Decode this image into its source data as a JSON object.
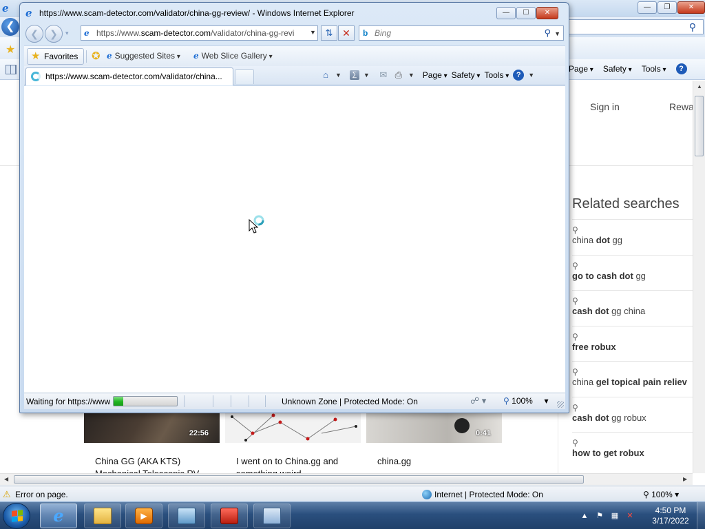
{
  "bg_window": {
    "cmd_menu": [
      "Page",
      "Safety",
      "Tools"
    ],
    "help": "?",
    "page": {
      "sign_in": "Sign in",
      "rewards": "Rewa",
      "related": {
        "title": "Related searches",
        "items": [
          {
            "pre": "china ",
            "bold": "dot",
            "post": " gg"
          },
          {
            "pre": "",
            "bold": "go to cash dot",
            "post": " gg"
          },
          {
            "pre": "",
            "bold": "cash dot",
            "post": " gg china"
          },
          {
            "pre": "",
            "bold": "free robux",
            "post": ""
          },
          {
            "pre": "china ",
            "bold": "gel topical pain reliev",
            "post": ""
          },
          {
            "pre": "",
            "bold": "cash dot",
            "post": " gg robux"
          },
          {
            "pre": "",
            "bold": "how to get robux",
            "post": ""
          }
        ]
      },
      "videos": [
        {
          "duration": "22:56",
          "title": "China GG (AKA KTS) Mechanical Telescopic RV"
        },
        {
          "duration": "",
          "title": "I went on to China.gg and something weird"
        },
        {
          "duration": "0:41",
          "title": "china.gg"
        }
      ]
    },
    "status": {
      "text": "Error on page.",
      "zone": "Internet | Protected Mode: On",
      "zoom": "100%"
    }
  },
  "fg_window": {
    "title": "https://www.scam-detector.com/validator/china-gg-review/ - Windows Internet Explorer",
    "address_prefix": "https://www.",
    "address_host": "scam-detector.com",
    "address_path": "/validator/china-gg-revi",
    "search_placeholder": "Bing",
    "favorites_label": "Favorites",
    "suggested_sites": "Suggested Sites",
    "web_slice_gallery": "Web Slice Gallery",
    "tab_title": "https://www.scam-detector.com/validator/china...",
    "cmd_menu": [
      "Page",
      "Safety",
      "Tools"
    ],
    "help": "?",
    "status": {
      "text": "Waiting for https://www",
      "progress": 0.15,
      "zone": "Unknown Zone | Protected Mode: On",
      "zoom": "100%"
    }
  },
  "taskbar": {
    "clock_time": "4:50 PM",
    "clock_date": "3/17/2022",
    "icons": [
      "internet-explorer-icon",
      "folder-icon",
      "media-player-icon",
      "network-icon",
      "toolbox-icon",
      "control-panel-icon"
    ]
  },
  "colors": {
    "accent": "#1f6ed4",
    "progress": "#1fb41f",
    "close": "#c5391c"
  }
}
